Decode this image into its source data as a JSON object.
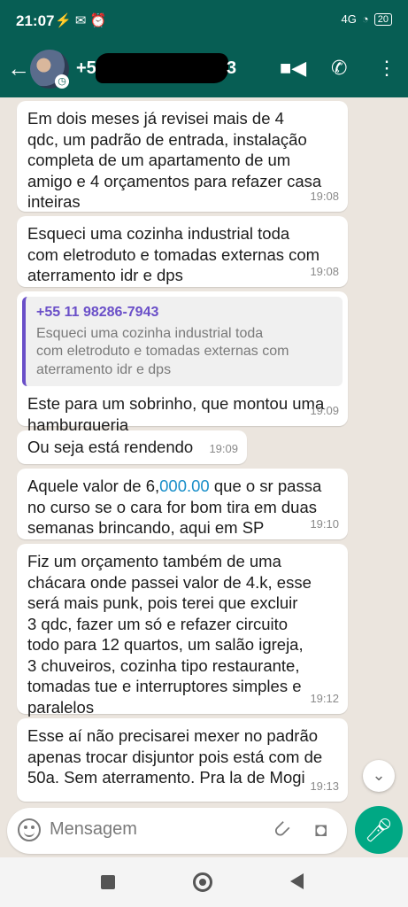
{
  "status_bar": {
    "time": "21:07",
    "icons": "⚡ ✉ ⏰",
    "signal": "4G",
    "battery": "20"
  },
  "header": {
    "contact_visible_prefix": "+5",
    "contact_visible_suffix": "3",
    "icons": [
      "back-arrow-icon",
      "video-call-icon",
      "phone-icon",
      "more-options-icon"
    ]
  },
  "messages": [
    {
      "text": "Em dois meses já revisei mais de 4\nqdc, um padrão de entrada, instalação\ncompleta de um apartamento de um\namigo e 4 orçamentos para refazer casa\ninteiras",
      "time": "19:08"
    },
    {
      "text": "Esqueci uma cozinha industrial toda\ncom eletroduto e tomadas externas com\naterramento idr e dps",
      "time": "19:08"
    },
    {
      "quote_name": "+55 11 98286-7943",
      "quote_text": "Esqueci uma cozinha industrial toda\ncom eletroduto e tomadas externas com\naterramento idr e dps",
      "text": "Este para um sobrinho, que montou uma\nhamburgueria",
      "time": "19:09"
    },
    {
      "text": "Ou seja está rendendo",
      "time": "19:09"
    },
    {
      "text_before": "Aquele valor de 6,",
      "link": "000.00",
      "text_after": " que o sr passa\nno curso se o cara for bom tira em duas\nsemanas brincando, aqui em SP",
      "time": "19:10"
    },
    {
      "text": "Fiz um orçamento também de uma\nchácara onde passei valor de 4.k, esse\nserá mais punk, pois terei que excluir\n3 qdc, fazer um só  e refazer circuito\ntodo para 12 quartos, um salão igreja,\n3 chuveiros, cozinha  tipo restaurante,\ntomadas tue e interruptores simples e\nparalelos",
      "time": "19:12"
    },
    {
      "text": "Esse aí não precisarei mexer no padrão\napenas trocar disjuntor pois está com de\n50a. Sem aterramento. Pra la de Mogi",
      "time": "19:13"
    }
  ],
  "composer": {
    "placeholder": "Mensagem"
  },
  "colors": {
    "header": "#075e54",
    "mic": "#00a884",
    "quote_accent": "#6a4fc8",
    "link": "#1a8fc9"
  }
}
